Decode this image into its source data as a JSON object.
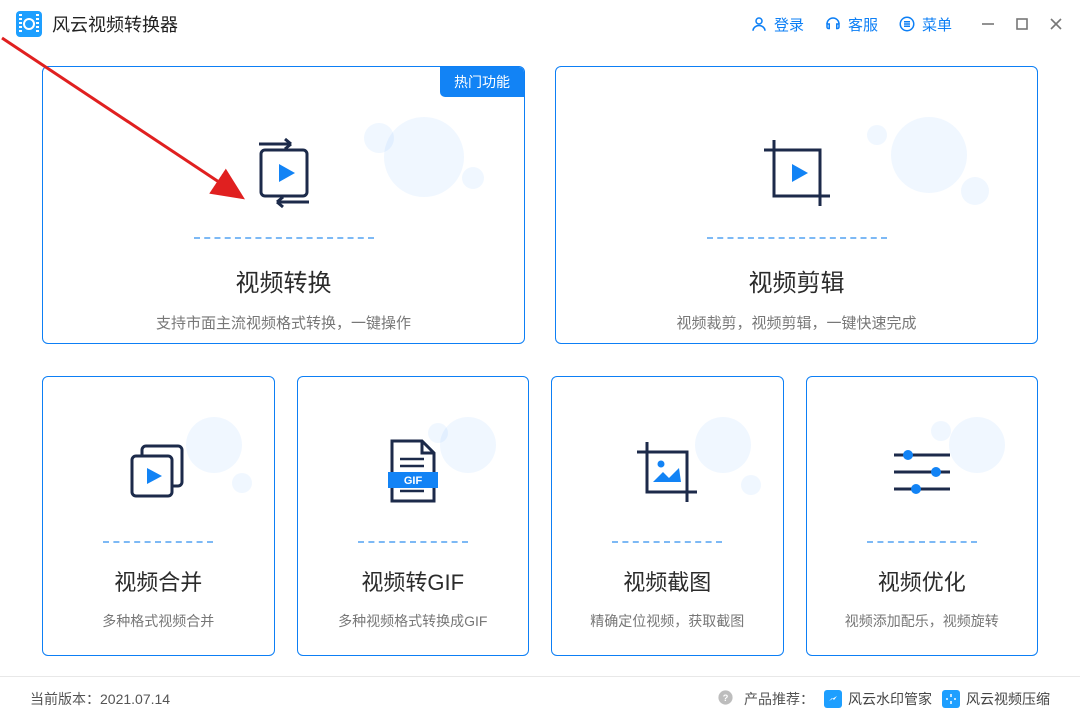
{
  "header": {
    "title": "风云视频转换器",
    "login": "登录",
    "support": "客服",
    "menu": "菜单"
  },
  "badge": "热门功能",
  "cards": {
    "convert": {
      "title": "视频转换",
      "desc": "支持市面主流视频格式转换，一键操作"
    },
    "edit": {
      "title": "视频剪辑",
      "desc": "视频裁剪，视频剪辑，一键快速完成"
    },
    "merge": {
      "title": "视频合并",
      "desc": "多种格式视频合并"
    },
    "gif": {
      "title": "视频转GIF",
      "desc": "多种视频格式转换成GIF",
      "gif_label": "GIF"
    },
    "shot": {
      "title": "视频截图",
      "desc": "精确定位视频，获取截图"
    },
    "optimize": {
      "title": "视频优化",
      "desc": "视频添加配乐，视频旋转"
    }
  },
  "footer": {
    "version_label": "当前版本：",
    "version": "2021.07.14",
    "recommend_label": "产品推荐：",
    "product1": "风云水印管家",
    "product2": "风云视频压缩"
  }
}
